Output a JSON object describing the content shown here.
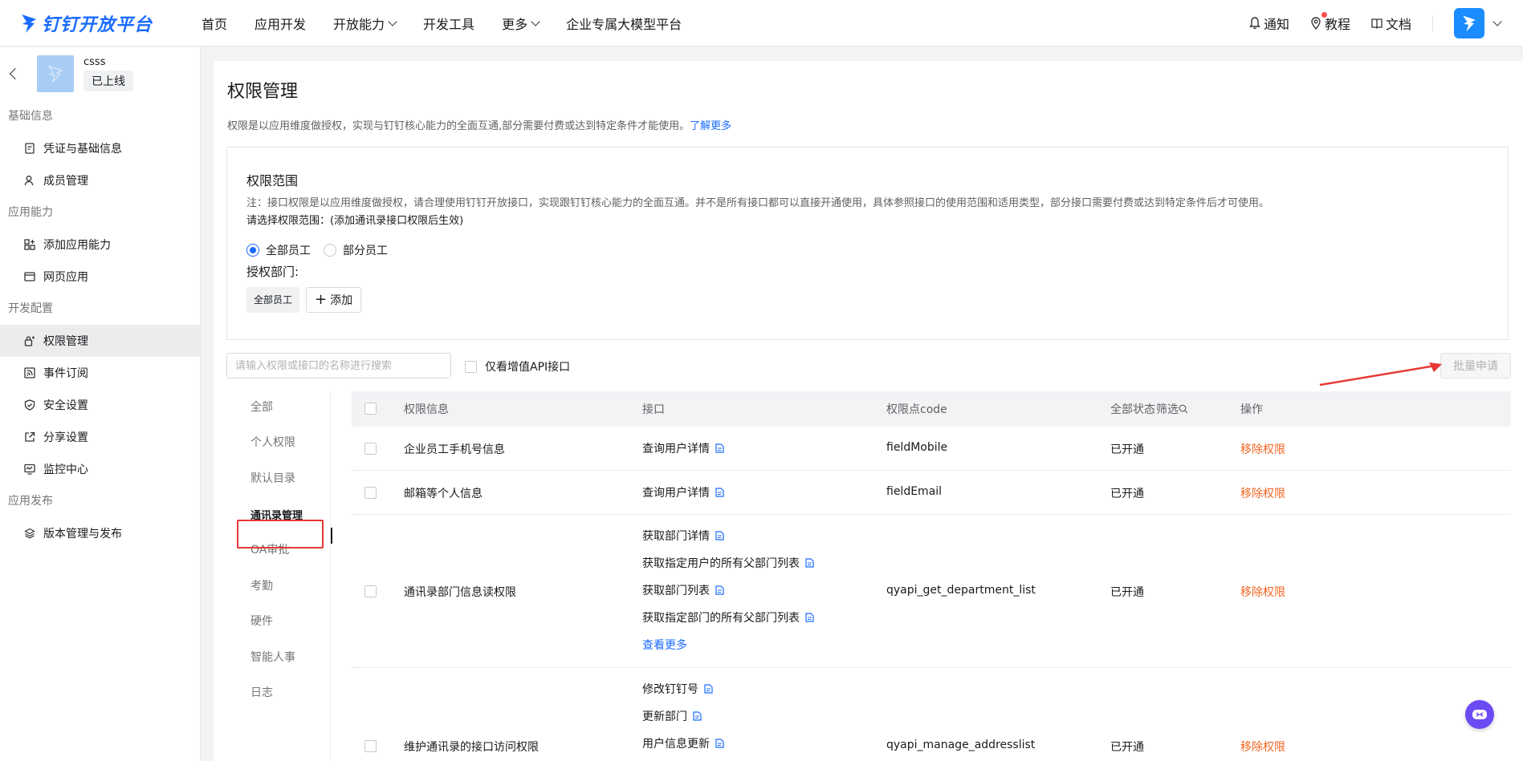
{
  "brand": {
    "logo_text": "钉钉开放平台"
  },
  "nav": {
    "items": [
      {
        "label": "首页",
        "dropdown": false
      },
      {
        "label": "应用开发",
        "dropdown": false
      },
      {
        "label": "开放能力",
        "dropdown": true
      },
      {
        "label": "开发工具",
        "dropdown": false
      },
      {
        "label": "更多",
        "dropdown": true
      },
      {
        "label": "企业专属大模型平台",
        "dropdown": false
      }
    ],
    "right": {
      "notify": "通知",
      "tutorial": "教程",
      "docs": "文档"
    }
  },
  "sidebar": {
    "app_name": "csss",
    "app_status": "已上线",
    "groups": [
      {
        "title": "基础信息",
        "items": [
          {
            "label": "凭证与基础信息",
            "icon": "credential-icon"
          },
          {
            "label": "成员管理",
            "icon": "member-icon"
          }
        ]
      },
      {
        "title": "应用能力",
        "items": [
          {
            "label": "添加应用能力",
            "icon": "apps-add-icon"
          },
          {
            "label": "网页应用",
            "icon": "webpage-icon"
          }
        ]
      },
      {
        "title": "开发配置",
        "items": [
          {
            "label": "权限管理",
            "icon": "permission-icon",
            "active": true
          },
          {
            "label": "事件订阅",
            "icon": "rss-icon"
          },
          {
            "label": "安全设置",
            "icon": "shield-icon"
          },
          {
            "label": "分享设置",
            "icon": "share-icon"
          },
          {
            "label": "监控中心",
            "icon": "monitor-icon"
          }
        ]
      },
      {
        "title": "应用发布",
        "items": [
          {
            "label": "版本管理与发布",
            "icon": "layers-icon"
          }
        ]
      }
    ]
  },
  "page": {
    "title": "权限管理",
    "desc": "权限是以应用维度做授权，实现与钉钉核心能力的全面互通,部分需要付费或达到特定条件才能使用。",
    "learn_more": "了解更多"
  },
  "scope": {
    "title": "权限范围",
    "note": "注：接口权限是以应用维度做授权，请合理使用钉钉开放接口，实现跟钉钉核心能力的全面互通。并不是所有接口都可以直接开通使用，具体参照接口的使用范围和适用类型，部分接口需要付费或达到特定条件后才可使用。",
    "choose": "请选择权限范围：(添加通讯录接口权限后生效)",
    "radio_all": "全部员工",
    "radio_part": "部分员工",
    "radio_selected": "全部员工",
    "dept_label": "授权部门:",
    "dept_tag": "全部员工",
    "add_label": "添加"
  },
  "toolbar": {
    "search_placeholder": "请输入权限或接口的名称进行搜索",
    "vas_only": "仅看增值API接口",
    "batch_apply": "批量申请"
  },
  "categories": [
    "全部",
    "个人权限",
    "默认目录",
    "通讯录管理",
    "OA审批",
    "考勤",
    "硬件",
    "智能人事",
    "日志"
  ],
  "active_category": "通讯录管理",
  "table": {
    "headers": {
      "info": "权限信息",
      "api": "接口",
      "code": "权限点code",
      "status": "全部状态",
      "filter": "筛选",
      "action": "操作"
    },
    "rows": [
      {
        "name": "企业员工手机号信息",
        "apis": [
          "查询用户详情"
        ],
        "code": "fieldMobile",
        "status": "已开通",
        "action": "移除权限"
      },
      {
        "name": "邮箱等个人信息",
        "apis": [
          "查询用户详情"
        ],
        "code": "fieldEmail",
        "status": "已开通",
        "action": "移除权限"
      },
      {
        "name": "通讯录部门信息读权限",
        "apis": [
          "获取部门详情",
          "获取指定用户的所有父部门列表",
          "获取部门列表",
          "获取指定部门的所有父部门列表"
        ],
        "more": "查看更多",
        "code": "qyapi_get_department_list",
        "status": "已开通",
        "action": "移除权限"
      },
      {
        "name": "维护通讯录的接口访问权限",
        "apis": [
          "修改钉钉号",
          "更新部门",
          "用户信息更新"
        ],
        "code": "qyapi_manage_addresslist",
        "status": "已开通",
        "action": "移除权限"
      }
    ]
  },
  "colors": {
    "brand": "#1a6bff",
    "danger": "#f26522",
    "annotation": "#e53935"
  }
}
